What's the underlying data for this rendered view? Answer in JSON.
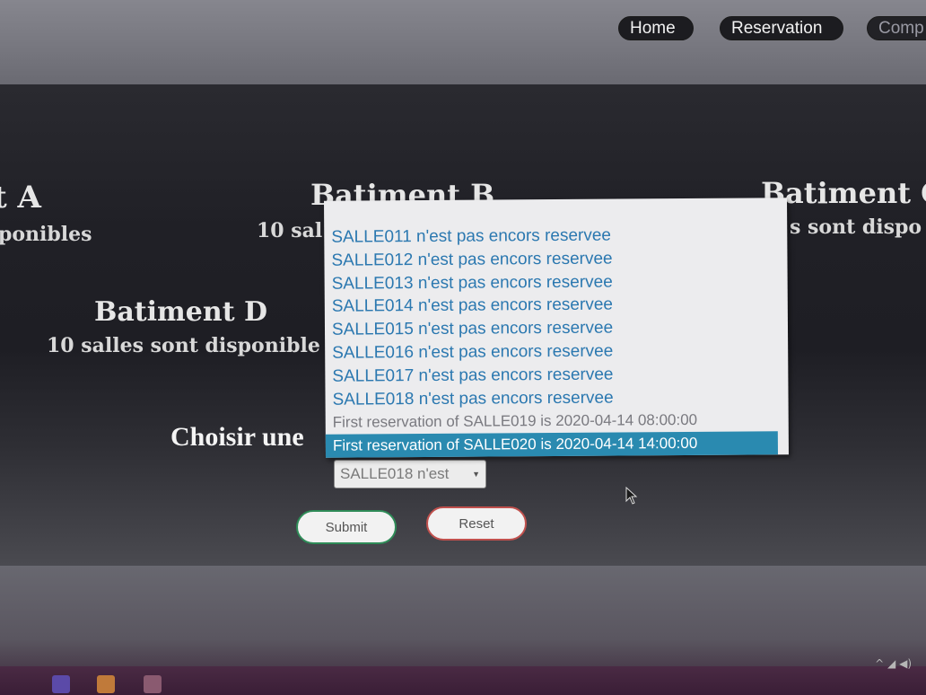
{
  "nav": {
    "home": "Home",
    "reservation": "Reservation",
    "comp": "Comp"
  },
  "buildings": {
    "a": {
      "title": "t A",
      "subtitle": "ponibles"
    },
    "b": {
      "title": "Batiment B",
      "subtitle": "10 sal"
    },
    "c": {
      "title": "Batiment C",
      "subtitle": "s sont dispo"
    },
    "d": {
      "title": "Batiment D",
      "subtitle": "10 salles sont disponible"
    }
  },
  "form": {
    "label": "Choisir une",
    "select_value": "SALLE018 n'est",
    "options": [
      "SALLE011 n'est pas encors reservee",
      "SALLE012 n'est pas encors reservee",
      "SALLE013 n'est pas encors reservee",
      "SALLE014 n'est pas encors reservee",
      "SALLE015 n'est pas encors reservee",
      "SALLE016 n'est pas encors reservee",
      "SALLE017 n'est pas encors reservee",
      "SALLE018 n'est pas encors reservee",
      "First reservation of SALLE019 is 2020-04-14 08:00:00",
      "First reservation of SALLE020 is 2020-04-14 14:00:00"
    ],
    "selected_index": 9,
    "submit": "Submit",
    "reset": "Reset"
  },
  "colors": {
    "option_text": "#2b78b0",
    "selected_bg": "#2a8ab0",
    "submit_border": "#2e8b57",
    "reset_border": "#c0504d"
  },
  "icons": [
    "cursor-icon",
    "chevron-down-icon",
    "tray-icons"
  ]
}
